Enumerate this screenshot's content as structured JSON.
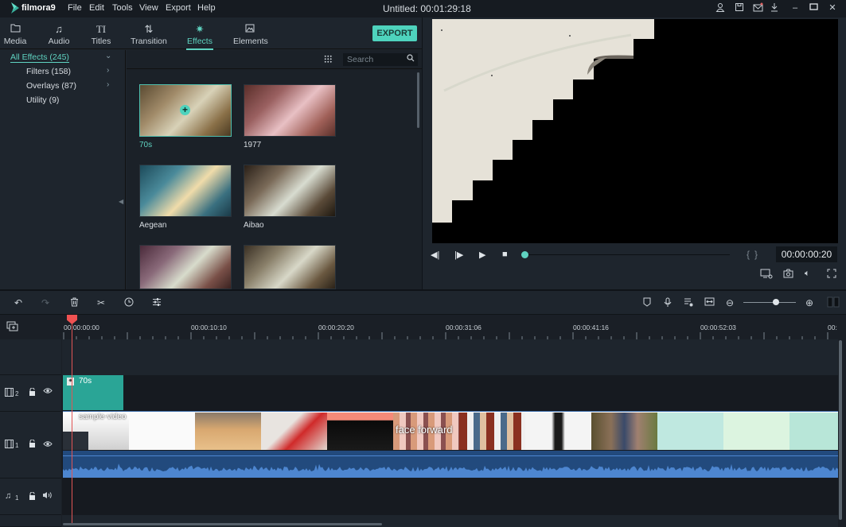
{
  "app": {
    "name": "filmora9",
    "title": "Untitled:",
    "duration": "00:01:29:18"
  },
  "menu": [
    "File",
    "Edit",
    "Tools",
    "View",
    "Export",
    "Help"
  ],
  "window_icons": [
    "user-icon",
    "save-icon",
    "mail-icon",
    "download-icon",
    "minimize-icon",
    "maximize-icon",
    "close-icon"
  ],
  "tabs": [
    {
      "label": "Media",
      "icon": "folder-icon"
    },
    {
      "label": "Audio",
      "icon": "music-note-icon"
    },
    {
      "label": "Titles",
      "icon": "text-icon"
    },
    {
      "label": "Transition",
      "icon": "transition-icon"
    },
    {
      "label": "Effects",
      "icon": "effects-icon",
      "active": true
    },
    {
      "label": "Elements",
      "icon": "image-icon"
    }
  ],
  "export_label": "EXPORT",
  "sidebar": {
    "items": [
      {
        "label": "All Effects (245)",
        "active": true
      },
      {
        "label": "Filters (158)"
      },
      {
        "label": "Overlays (87)"
      },
      {
        "label": "Utility (9)"
      }
    ]
  },
  "browser": {
    "search_placeholder": "Search",
    "effects": [
      {
        "name": "70s",
        "selected": true
      },
      {
        "name": "1977"
      },
      {
        "name": "Aegean"
      },
      {
        "name": "Aibao"
      },
      {
        "name": ""
      },
      {
        "name": ""
      }
    ]
  },
  "player": {
    "timecode": "00:00:00:20",
    "progress": 0.0,
    "mark_in": "{",
    "mark_out": "}"
  },
  "timeline": {
    "ruler_labels": [
      "00:00:00:00",
      "00:00:10:10",
      "00:00:20:20",
      "00:00:31:06",
      "00:00:41:16",
      "00:00:52:03",
      "00:"
    ],
    "zoom_level": 0.6,
    "tracks": [
      {
        "id": "video-2",
        "number": "2",
        "type": "video"
      },
      {
        "id": "video-1",
        "number": "1",
        "type": "video"
      },
      {
        "id": "audio-1",
        "number": "1",
        "type": "audio"
      }
    ],
    "clips": {
      "effect_clip": "70s",
      "video_clip": "sample-video",
      "video_overlay_text": "face forward"
    }
  },
  "colors": {
    "accent": "#4ed3bd",
    "playhead": "#f05252",
    "audio": "#224a7d",
    "wave": "#4d86d0"
  }
}
